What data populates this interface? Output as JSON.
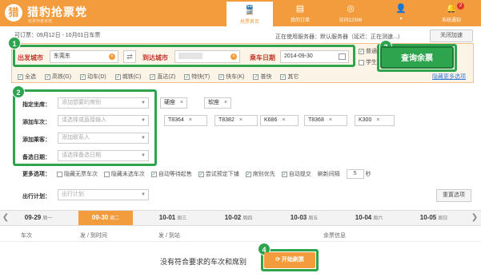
{
  "header": {
    "logo_glyph": "猎",
    "title": "猎豹抢票党",
    "subtitle": "抢票作者本地",
    "nav": [
      {
        "label": "抢票首页",
        "icon": "train-icon",
        "active": true
      },
      {
        "label": "我的订单",
        "icon": "order-icon",
        "active": false
      },
      {
        "label": "访问12306",
        "icon": "globe-icon",
        "active": false
      },
      {
        "label": "",
        "icon": "user-icon",
        "active": false
      },
      {
        "label": "系统通知",
        "icon": "bell-icon",
        "active": false,
        "badge": "2"
      }
    ]
  },
  "date_range_text": "可订票：09月12日 - 10月01日车票",
  "server_text": "正在使用服务器：默认服务器（延迟：正在测速...）",
  "close_speed_label": "关闭加速",
  "search": {
    "from_label": "出发城市",
    "from_value": "东莞东",
    "to_label": "到达城市",
    "date_label": "乘车日期",
    "date_value": "2014-09-30",
    "search_button": "查询余票",
    "type_ordinary": "普通",
    "type_student": "学生",
    "filters": [
      "全选",
      "高铁(G)",
      "动车(D)",
      "城铁(C)",
      "直达(Z)",
      "特快(T)",
      "快车(K)",
      "普快",
      "其它"
    ],
    "more_link": "隐藏更多选项"
  },
  "badges": [
    "1",
    "2",
    "3",
    "4"
  ],
  "options": {
    "seat_label": "指定坐席：",
    "seat_placeholder": "添加想要的席别",
    "seats": [
      "硬座",
      "软座"
    ],
    "train_label": "添加车次：",
    "train_placeholder": "请选择或直接输入",
    "trains": [
      "T8364",
      "T8382",
      "K686",
      "T8368",
      "K300"
    ],
    "passenger_label": "添加乘客：",
    "passenger_placeholder": "添加联系人",
    "backup_label": "备选日期：",
    "backup_placeholder": "请选择备选日期",
    "more_label": "更多选项：",
    "more_options": [
      {
        "label": "隐藏无票车次",
        "checked": false
      },
      {
        "label": "隐藏未选车次",
        "checked": false
      },
      {
        "label": "自动等待起售",
        "checked": true
      },
      {
        "label": "尝试预定下铺",
        "checked": true
      },
      {
        "label": "席别优先",
        "checked": true
      },
      {
        "label": "自动提交",
        "checked": true
      }
    ],
    "refresh_label": "刷新间隔",
    "refresh_value": "5",
    "refresh_unit": "秒",
    "plan_label": "出行计划：",
    "plan_placeholder": "出行计划",
    "reset_label": "重置选项"
  },
  "date_tabs": [
    {
      "date": "09-29",
      "day": "周一",
      "active": false
    },
    {
      "date": "09-30",
      "day": "周二",
      "active": true
    },
    {
      "date": "10-01",
      "day": "周三",
      "active": false
    },
    {
      "date": "10-02",
      "day": "周四",
      "active": false
    },
    {
      "date": "10-03",
      "day": "周五",
      "active": false
    },
    {
      "date": "10-04",
      "day": "周六",
      "active": false
    },
    {
      "date": "10-05",
      "day": "周日",
      "active": false
    }
  ],
  "columns": [
    "车次",
    "发 / 到时间",
    "发 / 到站",
    "余票信息"
  ],
  "empty_message": "没有符合要求的车次和席别",
  "start_button": "开始刷票",
  "colors": {
    "brand": "#f39c3d",
    "highlight": "#2ea44f"
  }
}
